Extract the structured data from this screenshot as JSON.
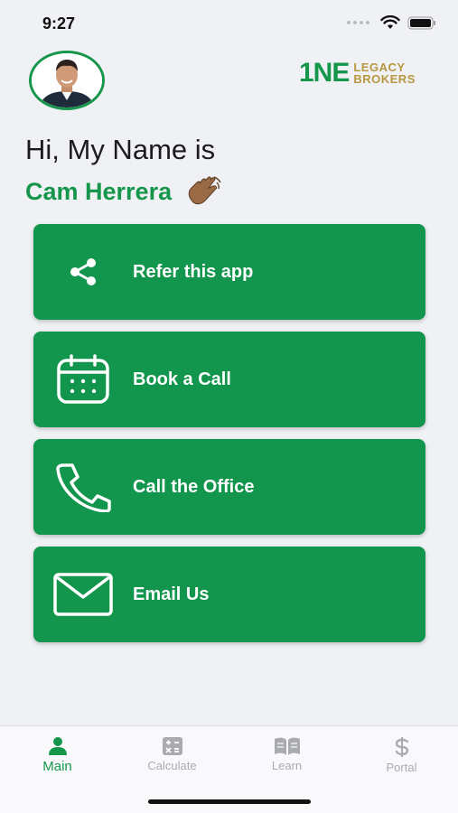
{
  "status_bar": {
    "time": "9:27"
  },
  "header": {
    "logo_main": "1NE",
    "logo_line1": "LEGACY",
    "logo_line2": "BROKERS"
  },
  "greeting": {
    "intro": "Hi, My Name is",
    "name": "Cam Herrera",
    "emoji_icon": "waving-hand-icon"
  },
  "actions": [
    {
      "label": "Refer this app",
      "icon": "share-icon"
    },
    {
      "label": "Book a Call",
      "icon": "calendar-icon"
    },
    {
      "label": "Call the Office",
      "icon": "phone-icon"
    },
    {
      "label": "Email Us",
      "icon": "envelope-icon"
    }
  ],
  "tab_bar": {
    "tabs": [
      {
        "label": "Main",
        "icon": "person-icon",
        "active": true
      },
      {
        "label": "Calculate",
        "icon": "calculator-icon",
        "active": false
      },
      {
        "label": "Learn",
        "icon": "book-icon",
        "active": false
      },
      {
        "label": "Portal",
        "icon": "dollar-icon",
        "active": false
      }
    ]
  },
  "colors": {
    "brand_green": "#12954c",
    "brand_gold": "#b7973f",
    "background": "#eff1f5"
  }
}
